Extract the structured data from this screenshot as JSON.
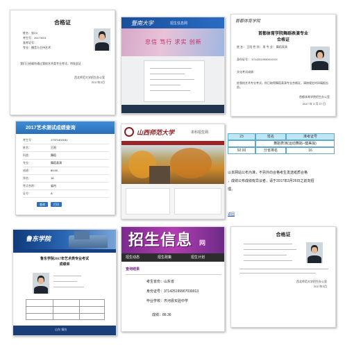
{
  "tiles": {
    "t1": {
      "title": "合格证",
      "line1": "姓名：张XX",
      "line2": "考生号：26173001",
      "line3": "准考证号：",
      "line4": "专业：播音与主持艺术",
      "note": "我们已经顺利通过我校艺术类专业考试，特发此证",
      "sign": "西北师范大学招生办公室",
      "date": "2017年3月"
    },
    "t2": {
      "header": "暨南大学",
      "header_sub": "招生信息网",
      "slogan": "忠信  笃行  求实  创新"
    },
    "t3": {
      "logo": "首都体育学院",
      "title": "首都体育学院舞蹈表演专业",
      "title2": "合格证",
      "row1": "姓    名：  王阳     性 别：  男     专 业：  舞蹈表演",
      "row2": "身份证号：  37142519990XXXXX",
      "row3": "文化考试成绩：  ",
      "text": "经我校艺术专业考试，你已取得舞蹈表演专业合格证，请按规定时间填报志愿。",
      "sign": "首都体育学院招生办公室",
      "date": "2017 年 3 月 27 日"
    },
    "t4": {
      "header": "2017艺术测试成绩查询",
      "rows": [
        {
          "label": "考生号：",
          "value": "17371402151"
        },
        {
          "label": "姓名：",
          "value": "王阳"
        },
        {
          "label": "科类：",
          "value": "舞蹈"
        },
        {
          "label": "专业：",
          "value": "舞蹈表演"
        },
        {
          "label": "成绩：",
          "value": "89.50"
        },
        {
          "label": "排名：",
          "value": "16"
        },
        {
          "label": "考点名称：",
          "value": "省内"
        },
        {
          "label": "证号：",
          "value": "A"
        }
      ],
      "btn1": "查询",
      "btn2": "打印"
    },
    "t5": {
      "logo": "山西师范大学",
      "sub": "本科招生网"
    },
    "t6": {
      "headers": [
        "23",
        "姓名",
        "准考证号"
      ],
      "row1": [
        "舞蹈表演(运动舞蹈--健美操)"
      ],
      "row2": [
        "92.00",
        "分省排名",
        "16"
      ],
      "note1": "以本网站公布为准，不另外向合格考生发送纸质合格",
      "note2": "，成绩公布成绩有异议者，请于2017年3月26日之前向招",
      "note3": "理。",
      "link": "返回"
    },
    "t7": {
      "logo": "鲁东学院",
      "title": "鲁东学院2017年艺术类专业考试",
      "subtitle": "成绩单",
      "footer": "山东·烟台"
    },
    "t8": {
      "banner": "招生信息",
      "banner_net": "网",
      "nav": [
        "招生动态",
        "招生政策",
        "招生计划"
      ],
      "result_title": "查询结果",
      "province": "考生省份：山东省",
      "idcard": "身份证号：371425199907030013",
      "school": "毕业学校：齐河县实验中学",
      "score": "成绩：86.36"
    },
    "t9": {
      "title": "合格证",
      "sign": "西北师范大学招生办公室",
      "date": "2017年3月"
    }
  }
}
